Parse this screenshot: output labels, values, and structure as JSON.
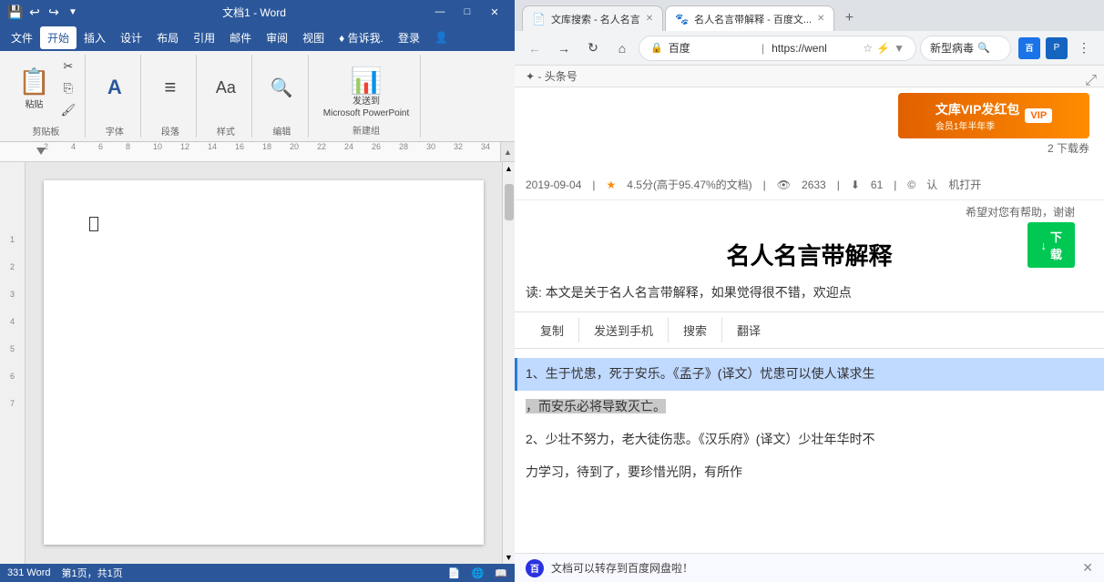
{
  "word": {
    "titlebar": {
      "title": "文档1 - Word",
      "quick_save": "💾",
      "quick_undo": "↩",
      "quick_redo": "↪",
      "quick_more": "▼",
      "min_btn": "—",
      "max_btn": "□",
      "close_btn": "✕"
    },
    "menubar": {
      "items": [
        "文件",
        "开始",
        "插入",
        "设计",
        "布局",
        "引用",
        "邮件",
        "审阅",
        "视图",
        "♦ 告诉我.",
        "登录",
        "👤"
      ]
    },
    "ribbon": {
      "clipboard": {
        "paste_label": "粘贴",
        "cut_icon": "✂",
        "copy_icon": "📋",
        "format_icon": "🖌"
      },
      "font_group": {
        "label": "字体",
        "icon": "A"
      },
      "paragraph_group": {
        "label": "段落",
        "icon": "≡"
      },
      "styles_group": {
        "label": "样式",
        "icon": "Aa"
      },
      "edit_group": {
        "label": "编辑",
        "icon": "🔍"
      },
      "send_ppt": {
        "label": "发送到\nMicrosoft PowerPoint",
        "icon": "📊"
      },
      "new_group": {
        "label": "新建组"
      }
    },
    "statusbar": {
      "words": "331 Word",
      "page_info": "页码: 1/1",
      "view_icons": [
        "📄",
        "📋",
        "🌐"
      ]
    },
    "ruler": {
      "numbers": [
        "2",
        "4",
        "6",
        "8",
        "10",
        "12",
        "14",
        "16",
        "18",
        "20",
        "22",
        "24",
        "26",
        "28",
        "30",
        "32",
        "34"
      ]
    }
  },
  "browser": {
    "titlebar": {},
    "tabs": [
      {
        "id": "tab1",
        "title": "文库搜索 - 名人名言",
        "favicon": "📄",
        "active": false
      },
      {
        "id": "tab2",
        "title": "名人名言带解释 - 百度文...",
        "favicon": "🐾",
        "active": true
      }
    ],
    "new_tab_label": "+",
    "addressbar": {
      "back": "←",
      "forward": "→",
      "refresh": "↻",
      "home": "⌂",
      "url": "https://wenl",
      "url_full": "https://wenku.baidu.com/...",
      "lock_icon": "🔒",
      "star_icon": "☆",
      "search_hint": "新型病毒",
      "extensions": [
        "百度",
        "🟦",
        "🔵"
      ]
    },
    "content": {
      "breadcrumb": "头条号",
      "ad_text": "文库VIP发红包赠",
      "ad_subtext": "会员1年半年季",
      "download_count": "2 下载券",
      "download_btn": "↓ 下载",
      "doc_meta": {
        "date": "2019-09-04",
        "star": "★",
        "score": "4.5分(高于95.47%的文档)",
        "views_icon": "👁",
        "views": "2633",
        "download_icon": "⬇",
        "downloads": "61",
        "copyright_icon": "©",
        "copyright": "认"
      },
      "open_hint": "机打开",
      "expand_icon": "⤢",
      "title": "名人名言带解释",
      "helper_text": "希望对您有帮助，谢谢",
      "excerpt": "读: 本文是关于名人名言带解释，如果觉得很不错，欢迎点",
      "action_buttons": [
        "复制",
        "发送到手机",
        "搜索",
        "翻译"
      ],
      "paragraphs": [
        {
          "id": "p1",
          "text": "1、生于忧患，死于安乐。《孟子》(译文）忧患可以使人谋求生",
          "highlighted": true
        },
        {
          "id": "p2",
          "text": "，而安乐必将导致灭亡。",
          "highlighted_partial": true
        },
        {
          "id": "p3",
          "text": "  2、少壮不努力，老大徒伤悲。《汉乐府》(译文）少壮年华时不",
          "highlighted": false
        },
        {
          "id": "p4",
          "text": "力学习，待到了，要珍惜光阴，有所作",
          "highlighted": false
        }
      ],
      "notification": {
        "logo": "百",
        "text": "文档可以转存到百度网盘啦！",
        "close": "✕"
      }
    }
  }
}
